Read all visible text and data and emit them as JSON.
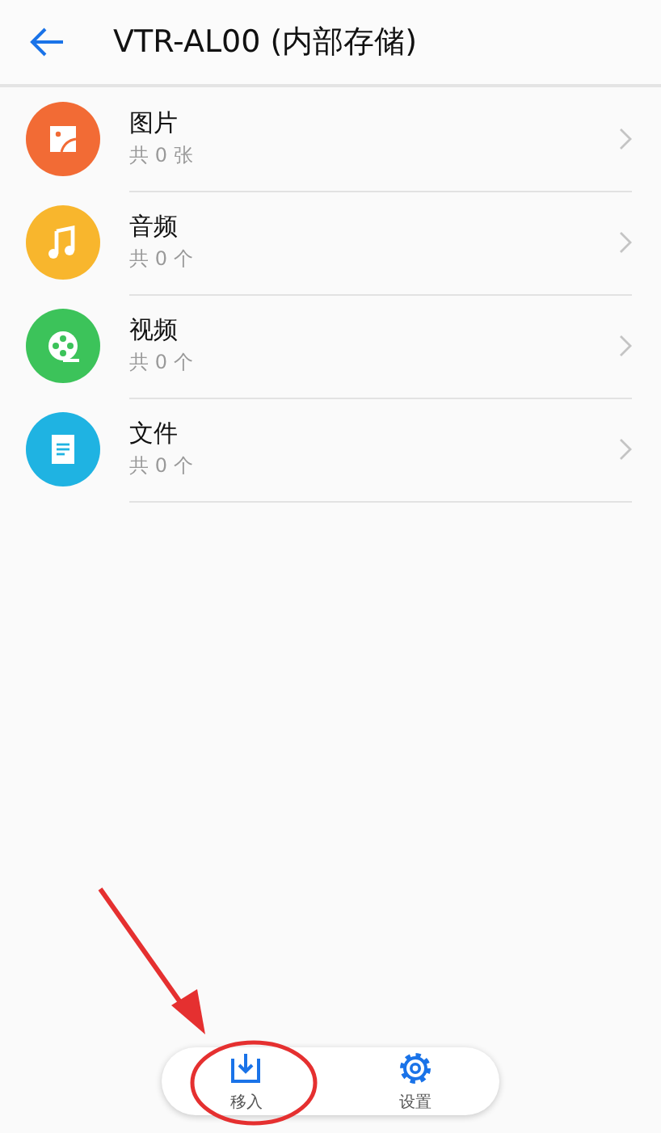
{
  "header": {
    "title": "VTR-AL00 (内部存储)"
  },
  "categories": [
    {
      "kind": "image",
      "color": "#f26b35",
      "name": "图片",
      "count": "共 0 张"
    },
    {
      "kind": "audio",
      "color": "#f8b62d",
      "name": "音频",
      "count": "共 0 个"
    },
    {
      "kind": "video",
      "color": "#3cc35a",
      "name": "视频",
      "count": "共 0 个"
    },
    {
      "kind": "document",
      "color": "#1fb3e2",
      "name": "文件",
      "count": "共 0 个"
    }
  ],
  "bottom_actions": [
    {
      "kind": "import",
      "label": "移入"
    },
    {
      "kind": "settings",
      "label": "设置"
    }
  ]
}
